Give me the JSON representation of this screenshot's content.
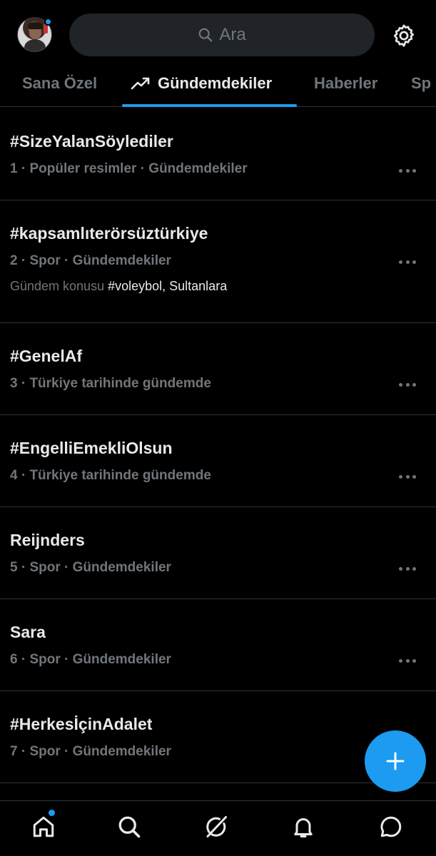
{
  "header": {
    "search_placeholder": "Ara"
  },
  "tabs": [
    {
      "label": "Sana Özel",
      "active": false
    },
    {
      "label": "Gündemdekiler",
      "active": true
    },
    {
      "label": "Haberler",
      "active": false
    },
    {
      "label": "Sp",
      "active": false
    }
  ],
  "trends": [
    {
      "title": "#SizeYalanSöylediler",
      "meta": "1 · Popüler resimler · Gündemdekiler"
    },
    {
      "title": "#kapsamlıterörsüztürkiye",
      "meta": "2 · Spor · Gündemdekiler",
      "extra_prefix": "Gündem konusu ",
      "extra_highlight": "#voleybol, Sultanlara"
    },
    {
      "title": "#GenelAf",
      "meta": "3 · Türkiye tarihinde gündemde"
    },
    {
      "title": "#EngelliEmekliOlsun",
      "meta": "4 · Türkiye tarihinde gündemde"
    },
    {
      "title": "Reijnders",
      "meta": "5 · Spor · Gündemdekiler"
    },
    {
      "title": "Sara",
      "meta": "6 · Spor · Gündemdekiler"
    },
    {
      "title": "#HerkesİçinAdalet",
      "meta": "7 · Spor · Gündemdekiler"
    }
  ],
  "colors": {
    "accent": "#1d9bf0",
    "background": "#000000",
    "text_primary": "#e7e9ea",
    "text_secondary": "#71767b"
  },
  "icons": {
    "search": "search-icon",
    "settings": "gear-icon",
    "trending": "trending-up-icon",
    "more": "more-horizontal-icon",
    "compose": "plus-icon",
    "nav": [
      "home-icon",
      "search-icon",
      "grok-icon",
      "bell-icon",
      "messages-icon"
    ]
  }
}
